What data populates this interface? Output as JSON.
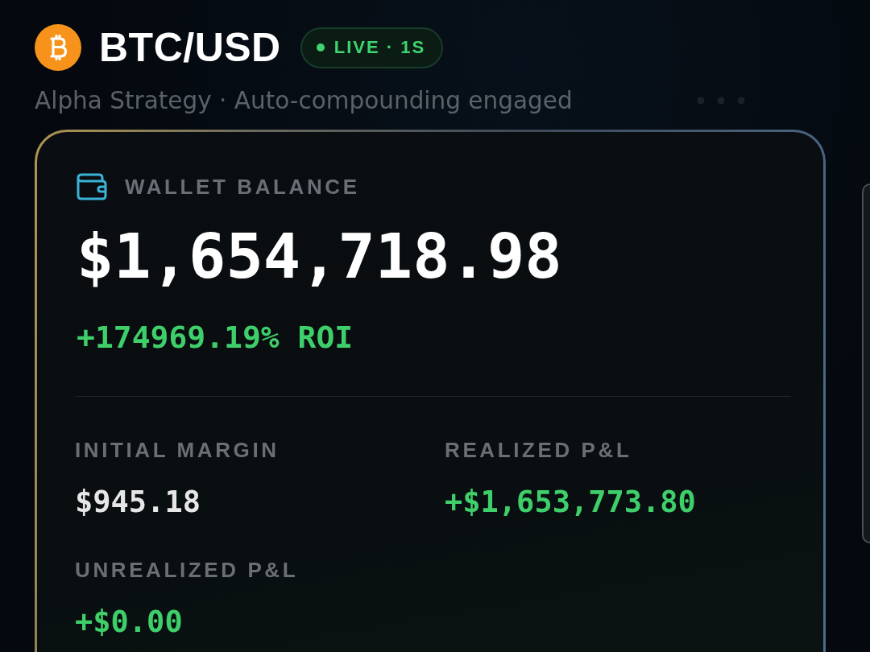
{
  "header": {
    "pair": "BTC/USD",
    "live_badge": {
      "text": "LIVE · 1S",
      "live": true
    },
    "subtitle": "Alpha Strategy · Auto-compounding engaged"
  },
  "wallet_card": {
    "label": "WALLET BALANCE",
    "balance": "$1,654,718.98",
    "roi": "+174969.19% ROI",
    "stats": [
      {
        "label": "INITIAL MARGIN",
        "value": "$945.18",
        "kind": "neutral"
      },
      {
        "label": "REALIZED P&L",
        "value": "+$1,653,773.80",
        "kind": "positive"
      },
      {
        "label": "UNREALIZED P&L",
        "value": "+$0.00",
        "kind": "positive"
      }
    ]
  }
}
